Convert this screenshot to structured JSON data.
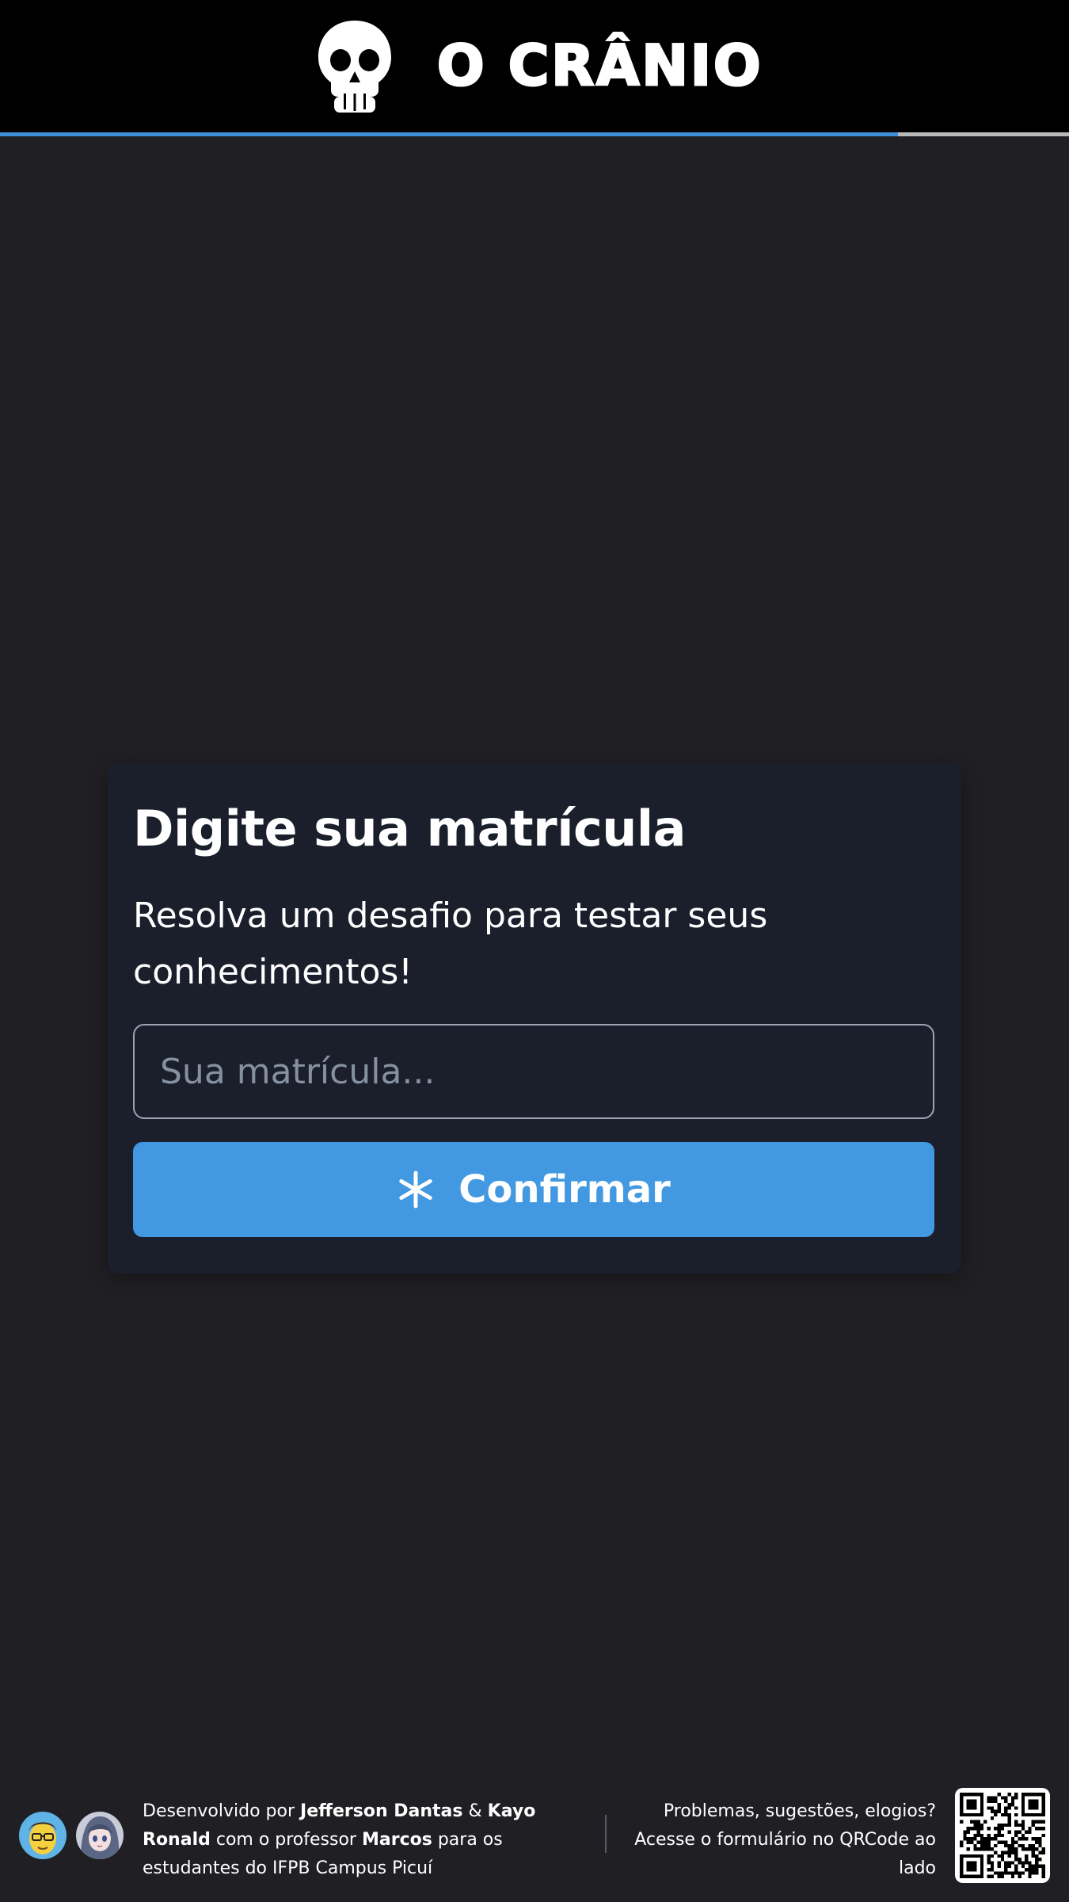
{
  "header": {
    "app_name": "O CRÂNIO",
    "logo_icon": "skull-icon",
    "progress_percent": 84,
    "progress_color": "#3d8fd9"
  },
  "card": {
    "title": "Digite sua matrícula",
    "subtitle": "Resolva um desafio para testar seus conhecimentos!",
    "input_placeholder": "Sua matrícula...",
    "input_value": "",
    "button_icon": "asterisk-icon",
    "button_label": "Confirmar",
    "accent_color": "#4299e1"
  },
  "footer": {
    "credits": {
      "prefix": "Desenvolvido por ",
      "author_1": "Jefferson Dantas",
      "connector": " & ",
      "author_2": "Kayo Ronald",
      "middle": " com o professor ",
      "professor": "Marcos",
      "suffix": " para os estudantes do IFPB Campus Picuí"
    },
    "feedback_line_1": "Problemas, sugestões, elogios?",
    "feedback_line_2": "Acesse o formulário no QRCode ao lado",
    "qr_icon": "qr-code-icon"
  }
}
